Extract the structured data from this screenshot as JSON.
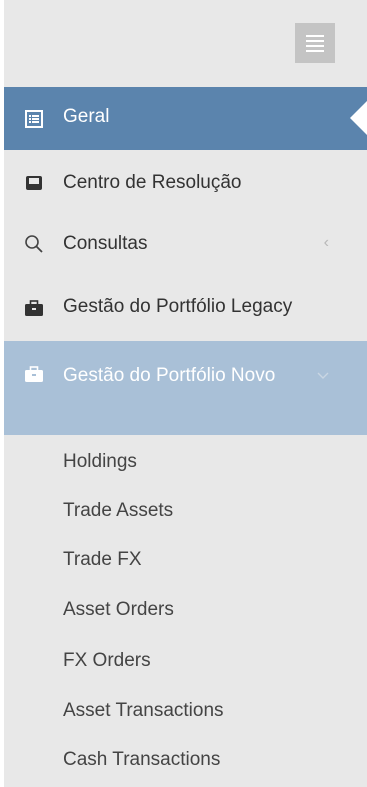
{
  "menu": {
    "geral": "Geral",
    "centro": "Centro de Resolução",
    "consultas": "Consultas",
    "legacy": "Gestão do Portfólio Legacy",
    "novo": "Gestão do Portfólio Novo",
    "submenu": [
      "Holdings",
      "Trade Assets",
      "Trade FX",
      "Asset Orders",
      "FX Orders",
      "Asset Transactions",
      "Cash Transactions"
    ]
  },
  "colors": {
    "active_bg": "#5b84ad",
    "expanded_bg": "#a9c0d7",
    "sidebar_bg": "#e8e8e8"
  },
  "icons": {
    "toggle": "hamburger-icon",
    "geral": "list-icon",
    "centro": "inbox-icon",
    "consultas": "search-icon",
    "legacy": "briefcase-icon",
    "novo": "briefcase-icon"
  }
}
